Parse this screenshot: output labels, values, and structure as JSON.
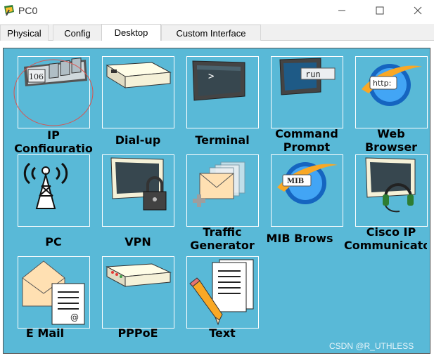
{
  "window": {
    "title": "PC0"
  },
  "tabs": [
    {
      "label": "Physical",
      "active": false
    },
    {
      "label": "Config",
      "active": false
    },
    {
      "label": "Desktop",
      "active": true
    },
    {
      "label": "Custom Interface",
      "active": false
    }
  ],
  "apps": [
    {
      "label_line1": "IP",
      "label_line2": "Configuratio",
      "icon": "ip-configuration-icon"
    },
    {
      "label_line1": "Dial-up",
      "icon": "modem-icon"
    },
    {
      "label_line1": "Terminal",
      "icon": "terminal-icon"
    },
    {
      "label_line1": "Command",
      "label_line2": "Prompt",
      "icon": "command-prompt-icon",
      "icon_text": "run"
    },
    {
      "label_line1": "Web",
      "label_line2": "Browser",
      "icon": "web-browser-icon",
      "icon_text": "http:"
    },
    {
      "label_line1": "PC",
      "icon": "wireless-tower-icon"
    },
    {
      "label_line1": "VPN",
      "icon": "vpn-lock-icon"
    },
    {
      "label_line1": "Traffic",
      "label_line2": "Generator",
      "icon": "traffic-generator-icon"
    },
    {
      "label_line1": "MIB Brows",
      "icon": "mib-browser-icon",
      "icon_text": "MIB"
    },
    {
      "label_line1": "Cisco IP",
      "label_line2": "Communicato",
      "icon": "headset-monitor-icon"
    },
    {
      "label_line1": "E Mail",
      "icon": "email-icon"
    },
    {
      "label_line1": "PPPoE",
      "icon": "pppoe-device-icon"
    },
    {
      "label_line1": "Text",
      "icon": "text-editor-icon"
    }
  ],
  "ip_icon_text": "106",
  "watermark": "CSDN @R_UTHLESS",
  "colors": {
    "desktop_bg": "#59b9d7",
    "highlight_ring": "#d9534f"
  }
}
